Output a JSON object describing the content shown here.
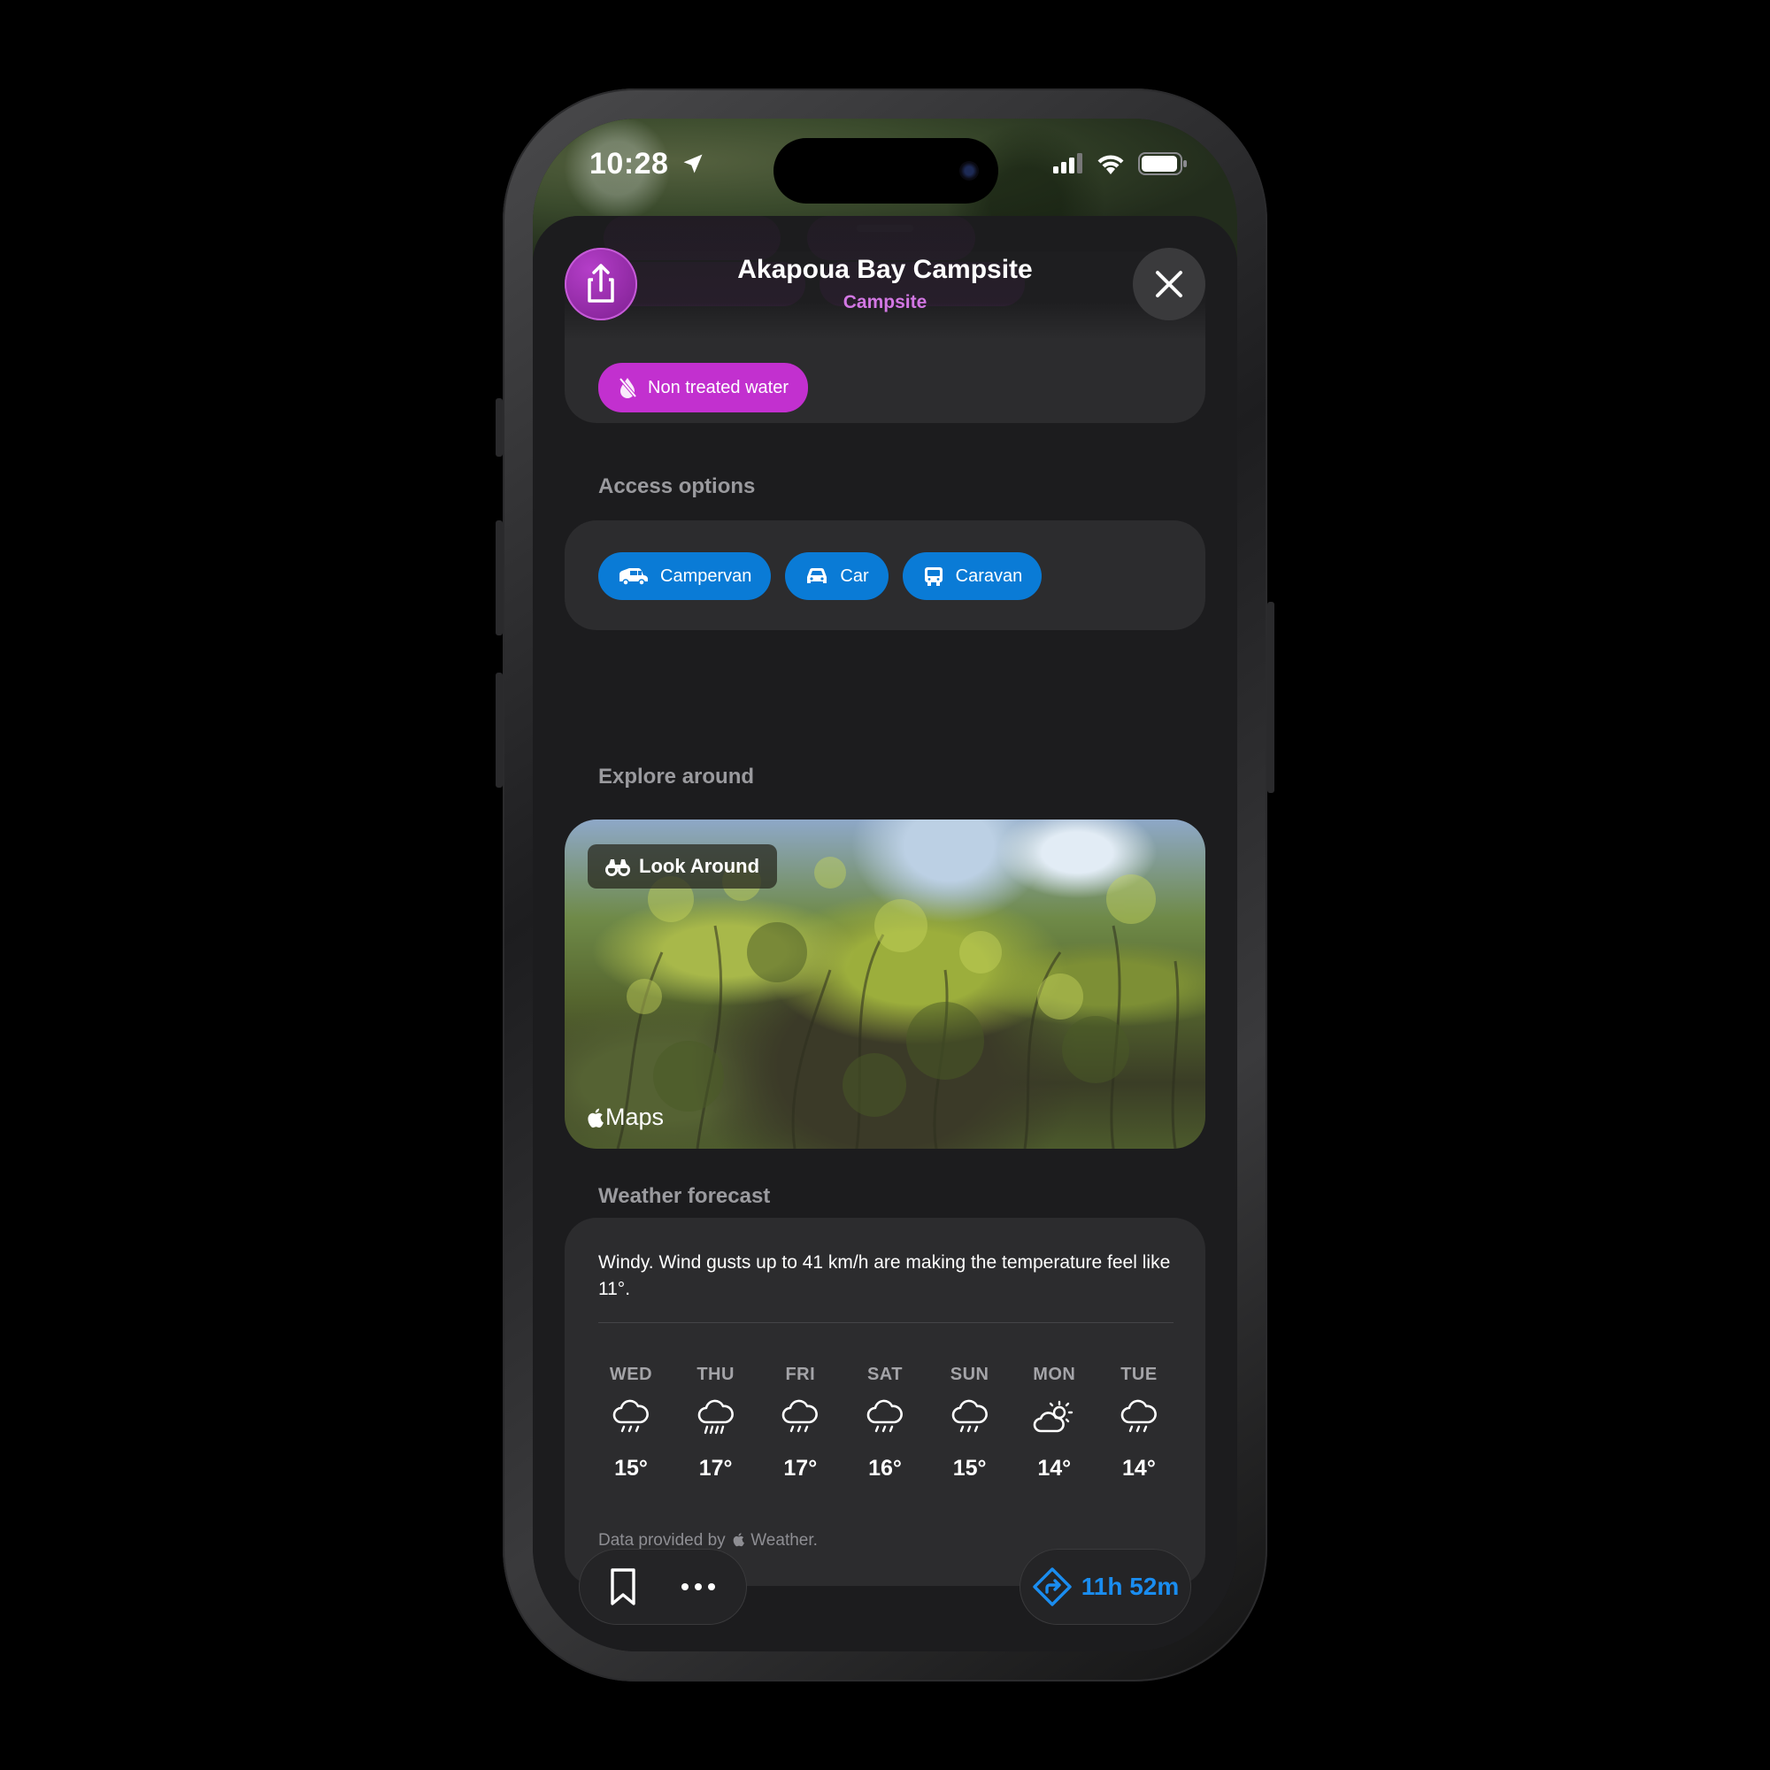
{
  "status_bar": {
    "time": "10:28"
  },
  "header": {
    "title": "Akapoua Bay Campsite",
    "subtitle": "Campsite"
  },
  "amenities": {
    "visible_tag": "Non treated water"
  },
  "access": {
    "heading": "Access options",
    "options": [
      {
        "label": "Campervan",
        "icon": "campervan-icon"
      },
      {
        "label": "Car",
        "icon": "car-icon"
      },
      {
        "label": "Caravan",
        "icon": "caravan-icon"
      }
    ]
  },
  "explore": {
    "heading": "Explore around",
    "look_around_label": "Look Around",
    "maps_label": "Maps"
  },
  "weather": {
    "heading": "Weather forecast",
    "summary": "Windy. Wind gusts up to 41 km/h are making the temperature feel like 11°.",
    "days": [
      {
        "day": "WED",
        "icon": "rain-icon",
        "temp": "15°"
      },
      {
        "day": "THU",
        "icon": "heavy-rain-icon",
        "temp": "17°"
      },
      {
        "day": "FRI",
        "icon": "rain-icon",
        "temp": "17°"
      },
      {
        "day": "SAT",
        "icon": "rain-icon",
        "temp": "16°"
      },
      {
        "day": "SUN",
        "icon": "rain-icon",
        "temp": "15°"
      },
      {
        "day": "MON",
        "icon": "partly-sunny-icon",
        "temp": "14°"
      },
      {
        "day": "TUE",
        "icon": "rain-icon",
        "temp": "14°"
      }
    ],
    "attribution_prefix": "Data provided by",
    "attribution_suffix": "Weather."
  },
  "actions": {
    "directions_eta": "11h 52m"
  },
  "colors": {
    "accent_purple": "#c230cf",
    "accent_blue": "#0a7bd6",
    "eta_blue": "#1a8df0",
    "sheet_bg": "#1c1c1e",
    "card_bg": "#2c2c2e"
  }
}
